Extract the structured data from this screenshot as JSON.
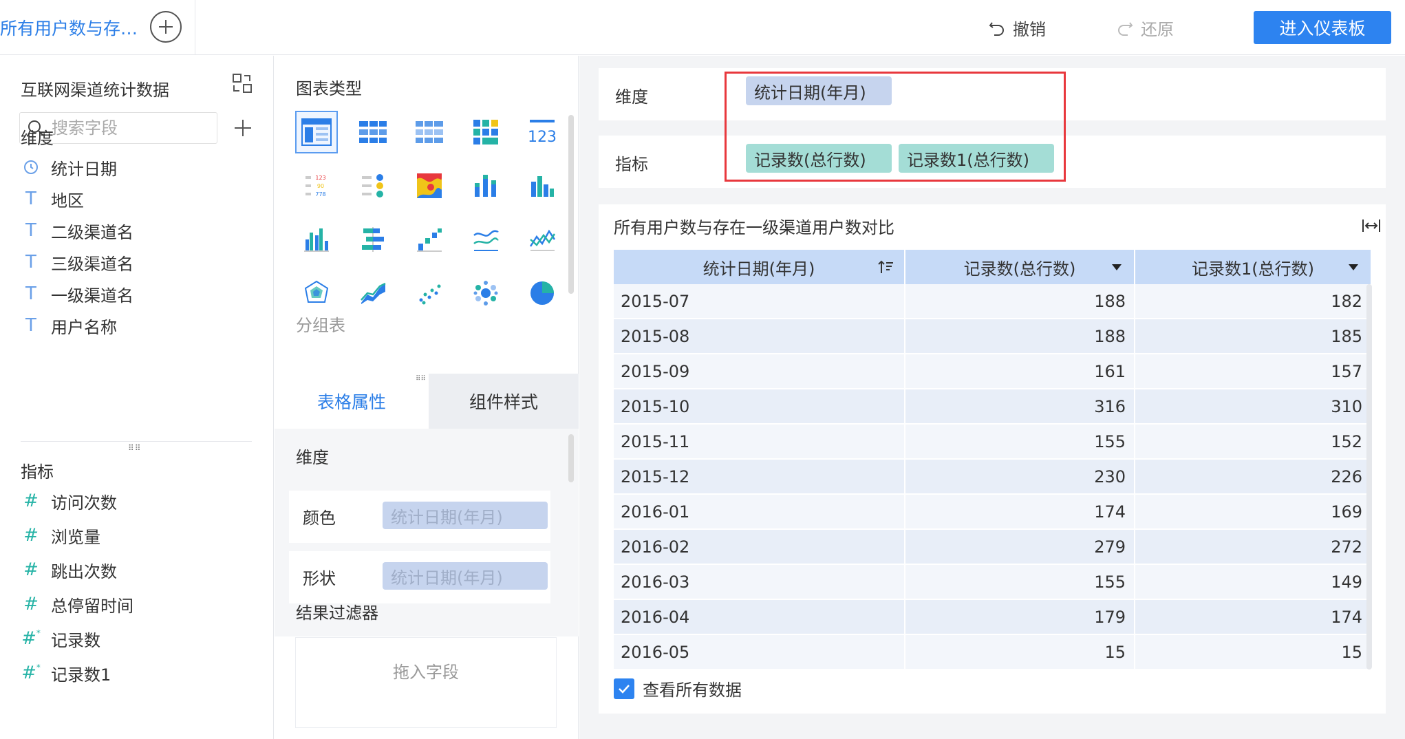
{
  "topbar": {
    "tab_title": "所有用户数与存…",
    "undo_label": "撤销",
    "redo_label": "还原",
    "enter_dashboard_label": "进入仪表板"
  },
  "left": {
    "dataset_title": "互联网渠道统计数据",
    "search_placeholder": "搜索字段",
    "dimension_title": "维度",
    "dimensions": [
      {
        "label": "统计日期",
        "icon": "clock-icon"
      },
      {
        "label": "地区",
        "icon": "text-type-icon"
      },
      {
        "label": "二级渠道名",
        "icon": "text-type-icon"
      },
      {
        "label": "三级渠道名",
        "icon": "text-type-icon"
      },
      {
        "label": "一级渠道名",
        "icon": "text-type-icon"
      },
      {
        "label": "用户名称",
        "icon": "text-type-icon"
      }
    ],
    "measure_title": "指标",
    "measures": [
      {
        "label": "访问次数",
        "icon": "hash-icon"
      },
      {
        "label": "浏览量",
        "icon": "hash-icon"
      },
      {
        "label": "跳出次数",
        "icon": "hash-icon"
      },
      {
        "label": "总停留时间",
        "icon": "hash-icon"
      },
      {
        "label": "记录数",
        "icon": "hash-calc-icon"
      },
      {
        "label": "记录数1",
        "icon": "hash-calc-icon"
      }
    ]
  },
  "middle": {
    "chart_type_title": "图表类型",
    "selected_chart_label": "分组表",
    "tabs": [
      "表格属性",
      "组件样式"
    ],
    "prop_dimension_title": "维度",
    "color_label": "颜色",
    "color_field": "统计日期(年月)",
    "shape_label": "形状",
    "shape_field": "统计日期(年月)",
    "filter_title": "结果过滤器",
    "filter_placeholder": "拖入字段"
  },
  "right": {
    "dimension_label": "维度",
    "dimension_field": "统计日期(年月)",
    "measure_label": "指标",
    "measure_fields": [
      "记录数(总行数)",
      "记录数1(总行数)"
    ],
    "table_title": "所有用户数与存在一级渠道用户数对比",
    "columns": [
      "统计日期(年月)",
      "记录数(总行数)",
      "记录数1(总行数)"
    ],
    "rows": [
      [
        "2015-07",
        "188",
        "182"
      ],
      [
        "2015-08",
        "188",
        "185"
      ],
      [
        "2015-09",
        "161",
        "157"
      ],
      [
        "2015-10",
        "316",
        "310"
      ],
      [
        "2015-11",
        "155",
        "152"
      ],
      [
        "2015-12",
        "230",
        "226"
      ],
      [
        "2016-01",
        "174",
        "169"
      ],
      [
        "2016-02",
        "279",
        "272"
      ],
      [
        "2016-03",
        "155",
        "149"
      ],
      [
        "2016-04",
        "179",
        "174"
      ],
      [
        "2016-05",
        "15",
        "15"
      ]
    ],
    "view_all_label": "查看所有数据",
    "view_all_checked": true
  },
  "colors": {
    "accent": "#2d83f0",
    "dimension_chip": "#c6d4ee",
    "measure_chip": "#a4ddd6",
    "highlight": "#e8383d",
    "table_header": "#c6daf7",
    "row_even": "#f3f6fb",
    "row_odd": "#e8eef8"
  }
}
